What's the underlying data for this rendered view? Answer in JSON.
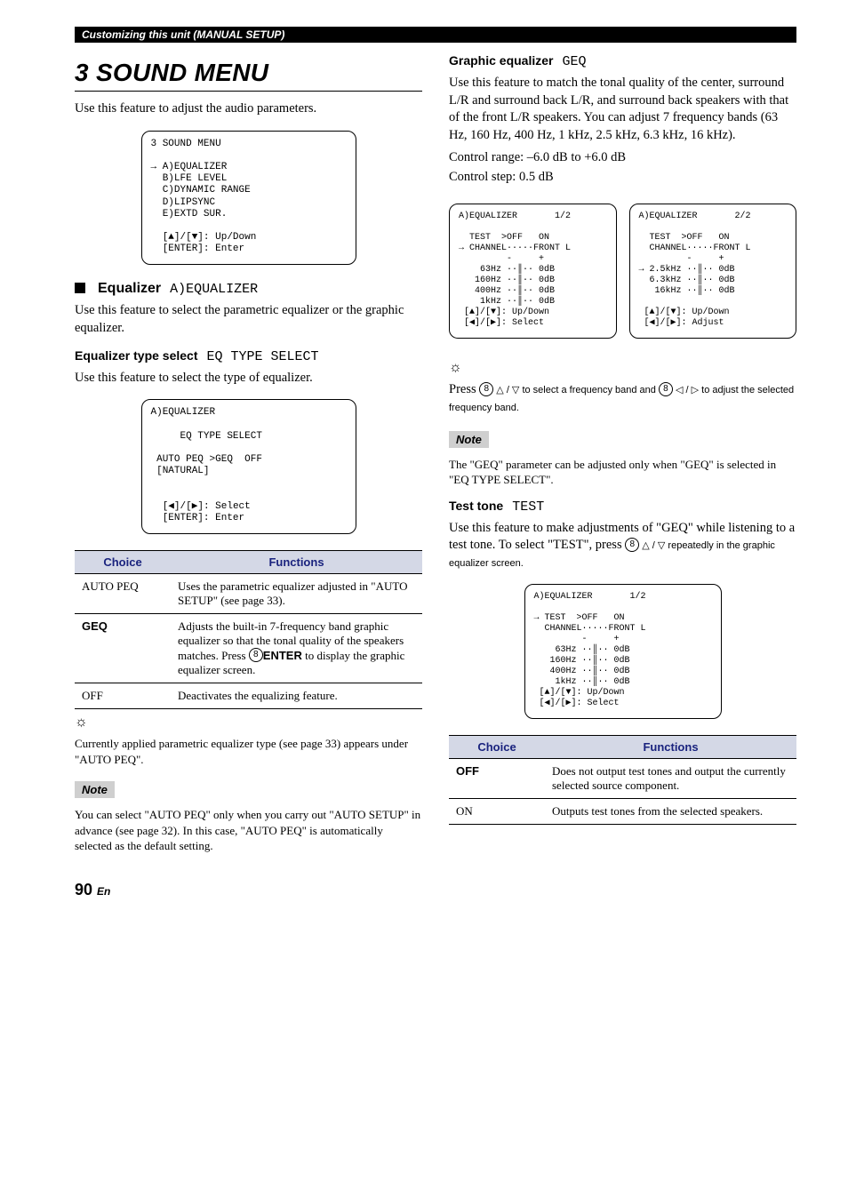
{
  "header_bar": "Customizing this unit (MANUAL SETUP)",
  "left": {
    "title": "3 SOUND MENU",
    "intro": "Use this feature to adjust the audio parameters.",
    "lcd_menu": "3 SOUND MENU\n\n→ A)EQUALIZER\n  B)LFE LEVEL\n  C)DYNAMIC RANGE\n  D)LIPSYNC\n  E)EXTD SUR.\n\n  [▲]/[▼]: Up/Down\n  [ENTER]: Enter",
    "eq_head": "Equalizer",
    "eq_head_lcd": "A)EQUALIZER",
    "eq_desc": "Use this feature to select the parametric equalizer or the graphic equalizer.",
    "eqtype_head": "Equalizer type select",
    "eqtype_head_lcd": "EQ TYPE SELECT",
    "eqtype_desc": "Use this feature to select the type of equalizer.",
    "lcd_eqtype": "A)EQUALIZER\n\n     EQ TYPE SELECT\n\n AUTO PEQ >GEQ  OFF\n [NATURAL]\n\n\n  [◀]/[▶]: Select\n  [ENTER]: Enter",
    "table": {
      "h1": "Choice",
      "h2": "Functions",
      "rows": [
        {
          "c": "AUTO PEQ",
          "bold": false,
          "f": "Uses the parametric equalizer adjusted in \"AUTO SETUP\" (see page 33)."
        },
        {
          "c": "GEQ",
          "bold": true,
          "f_pre": "Adjusts the built-in 7-frequency band graphic equalizer so that the tonal quality of the speakers matches. Press ",
          "f_btn_num": "8",
          "f_btn_label": "ENTER",
          "f_post": " to display the graphic equalizer screen."
        },
        {
          "c": "OFF",
          "bold": false,
          "f": "Deactivates the equalizing feature."
        }
      ]
    },
    "tip_icon": "☼",
    "tip_text": "Currently applied parametric equalizer type (see page 33) appears under \"AUTO PEQ\".",
    "note_label": "Note",
    "note_text": "You can select \"AUTO PEQ\" only when you carry out \"AUTO SETUP\" in advance (see page 32). In this case, \"AUTO PEQ\" is automatically selected as the default setting."
  },
  "right": {
    "geq_head": "Graphic equalizer",
    "geq_head_lcd": "GEQ",
    "geq_desc": "Use this feature to match the tonal quality of the center, surround L/R and surround back L/R, and surround back speakers with that of the front L/R speakers. You can adjust 7 frequency bands (63 Hz, 160 Hz, 400 Hz, 1 kHz, 2.5 kHz, 6.3 kHz, 16 kHz).",
    "ctrl_range": "Control range: –6.0 dB to +6.0 dB",
    "ctrl_step": "Control step: 0.5 dB",
    "lcd_geq1": "A)EQUALIZER       1/2\n\n  TEST  >OFF   ON\n→ CHANNEL·····FRONT L\n         -     +\n    63Hz ··║·· 0dB\n   160Hz ··║·· 0dB\n   400Hz ··║·· 0dB\n    1kHz ··║·· 0dB\n [▲]/[▼]: Up/Down\n [◀]/[▶]: Select",
    "lcd_geq2": "A)EQUALIZER       2/2\n\n  TEST  >OFF   ON\n  CHANNEL·····FRONT L\n         -     +\n→ 2.5kHz ··║·· 0dB\n  6.3kHz ··║·· 0dB\n   16kHz ··║·· 0dB\n\n [▲]/[▼]: Up/Down\n [◀]/[▶]: Adjust",
    "tip_icon": "☼",
    "tip_pre": "Press ",
    "tip_num": "8",
    "tip_mid1": " △ / ▽ to select a frequency band and ",
    "tip_mid2": " ◁ / ▷ to adjust the selected frequency band.",
    "note_label": "Note",
    "note_text": "The \"GEQ\" parameter can be adjusted only when \"GEQ\" is selected in \"EQ TYPE SELECT\".",
    "test_head": "Test tone",
    "test_head_lcd": "TEST",
    "test_desc_pre": "Use this feature to make adjustments of \"GEQ\" while listening to a test tone. To select \"TEST\", press ",
    "test_desc_num": "8",
    "test_desc_post": " △ / ▽ repeatedly in the graphic equalizer screen.",
    "lcd_test": "A)EQUALIZER       1/2\n\n→ TEST  >OFF   ON\n  CHANNEL·····FRONT L\n         -     +\n    63Hz ··║·· 0dB\n   160Hz ··║·· 0dB\n   400Hz ··║·· 0dB\n    1kHz ··║·· 0dB\n [▲]/[▼]: Up/Down\n [◀]/[▶]: Select",
    "table": {
      "h1": "Choice",
      "h2": "Functions",
      "rows": [
        {
          "c": "OFF",
          "bold": true,
          "f": "Does not output test tones and output the currently selected source component."
        },
        {
          "c": "ON",
          "bold": false,
          "f": "Outputs test tones from the selected speakers."
        }
      ]
    }
  },
  "page_number": "90",
  "page_lang": "En"
}
